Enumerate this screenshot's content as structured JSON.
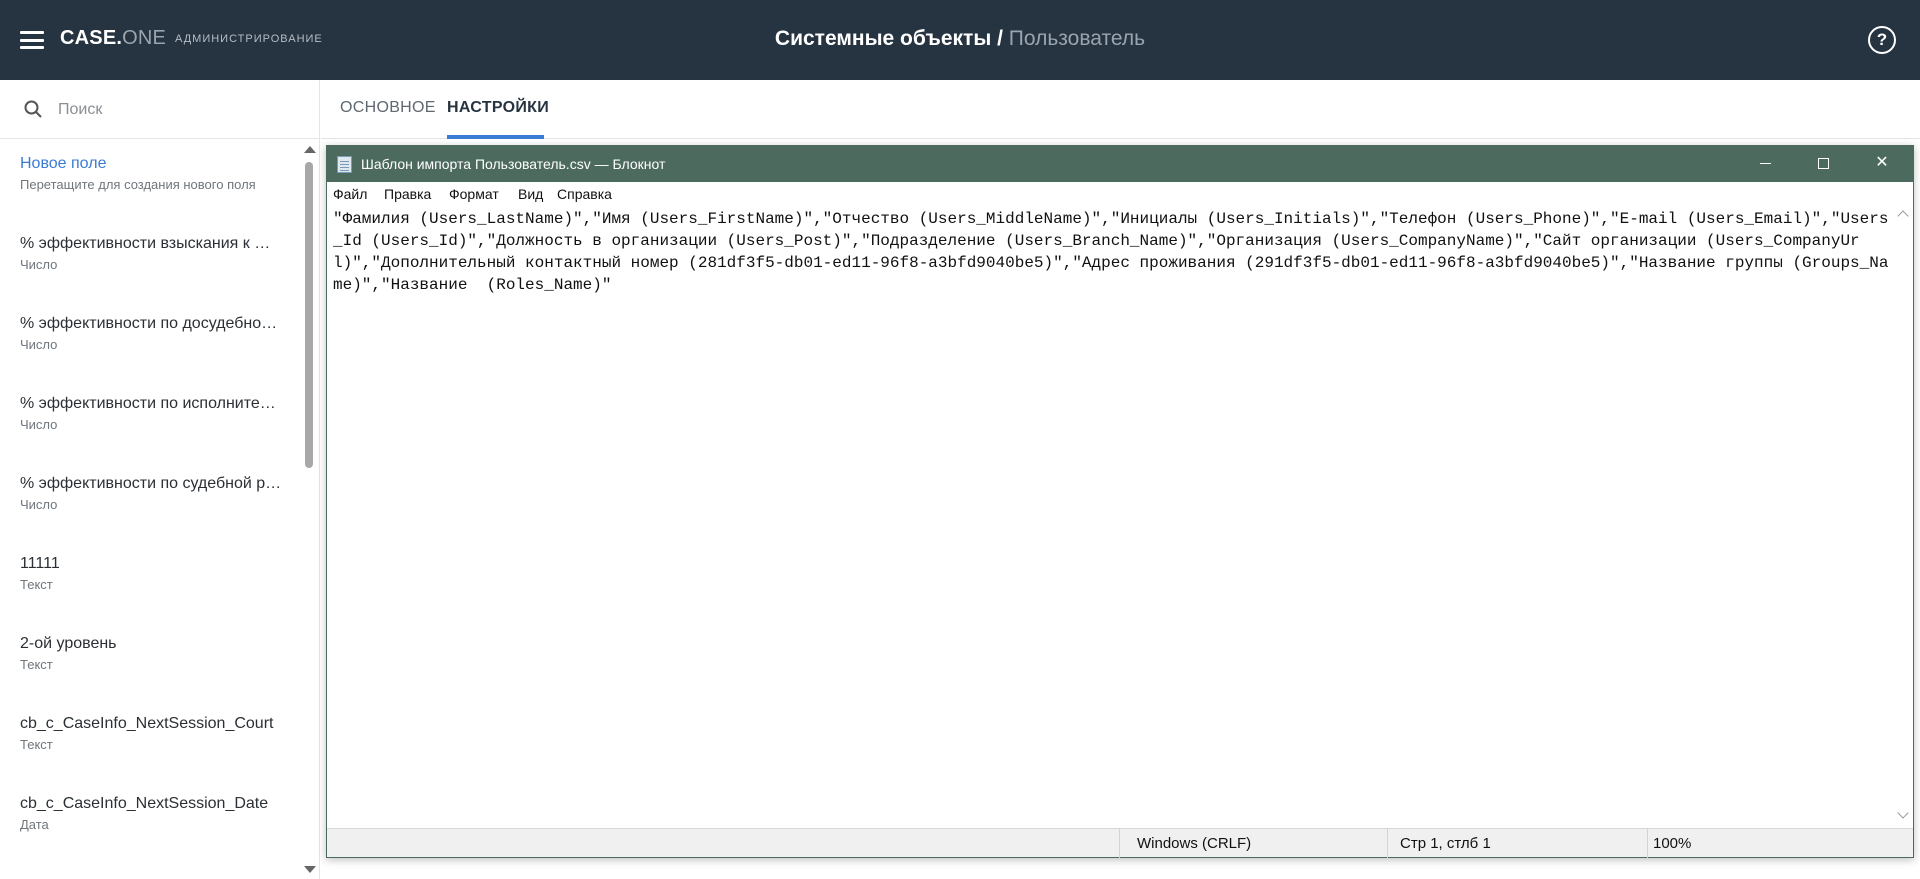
{
  "app": {
    "logo_main": "CASE.",
    "logo_accent": "ONE",
    "admin_label": "АДМИНИСТРИРОВАНИЕ",
    "title_main": "Системные объекты / ",
    "title_sub": "Пользователь",
    "help_glyph": "?"
  },
  "sidebar": {
    "search_placeholder": "Поиск",
    "items": [
      {
        "name": "Новое поле",
        "type": "Перетащите для создания нового поля"
      },
      {
        "name": "% эффективности взыскания к …",
        "type": "Число"
      },
      {
        "name": "% эффективности по досудебно…",
        "type": "Число"
      },
      {
        "name": "% эффективности по исполните…",
        "type": "Число"
      },
      {
        "name": "% эффективности по судебной р…",
        "type": "Число"
      },
      {
        "name": "11111",
        "type": "Текст"
      },
      {
        "name": "2-ой уровень",
        "type": "Текст"
      },
      {
        "name": "cb_c_CaseInfo_NextSession_Court",
        "type": "Текст"
      },
      {
        "name": "cb_c_CaseInfo_NextSession_Date",
        "type": "Дата"
      }
    ]
  },
  "tabs": [
    {
      "label": "ОСНОВНОЕ",
      "active": false
    },
    {
      "label": "НАСТРОЙКИ",
      "active": true
    }
  ],
  "notepad": {
    "title": "Шаблон импорта Пользователь.csv — Блокнот",
    "buttons": {
      "minimize": "",
      "maximize": "",
      "close": "✕"
    },
    "menu": [
      "Файл",
      "Правка",
      "Формат",
      "Вид",
      "Справка"
    ],
    "content": "\"Фамилия (Users_LastName)\",\"Имя (Users_FirstName)\",\"Отчество (Users_MiddleName)\",\"Инициалы (Users_Initials)\",\"Телефон (Users_Phone)\",\"E-mail (Users_Email)\",\"Users_Id (Users_Id)\",\"Должность в организации (Users_Post)\",\"Подразделение (Users_Branch_Name)\",\"Организация (Users_CompanyName)\",\"Сайт организации (Users_CompanyUrl)\",\"Дополнительный контактный номер (281df3f5-db01-ed11-96f8-a3bfd9040be5)\",\"Адрес проживания (291df3f5-db01-ed11-96f8-a3bfd9040be5)\",\"Название группы (Groups_Name)\",\"Название  (Roles_Name)\"",
    "status": {
      "line_ending": "Windows (CRLF)",
      "position": "Стр 1, стлб 1",
      "zoom": "100%"
    }
  },
  "colors": {
    "topbar": "#263340",
    "accent": "#3a7bd5",
    "notepad_titlebar": "#4d6a5f"
  }
}
